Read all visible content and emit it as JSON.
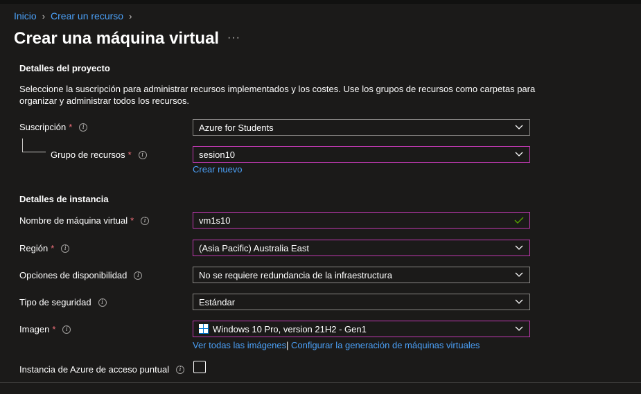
{
  "breadcrumb": {
    "home": "Inicio",
    "create_resource": "Crear un recurso"
  },
  "page": {
    "title": "Crear una máquina virtual",
    "more": "···"
  },
  "project": {
    "heading": "Detalles del proyecto",
    "description": "Seleccione la suscripción para administrar recursos implementados y los costes. Use los grupos de recursos como carpetas para organizar y administrar todos los recursos.",
    "subscription_label": "Suscripción",
    "subscription_value": "Azure for Students",
    "resource_group_label": "Grupo de recursos",
    "resource_group_value": "sesion10",
    "create_new_link": "Crear nuevo"
  },
  "instance": {
    "heading": "Detalles de instancia",
    "vm_name_label": "Nombre de máquina virtual",
    "vm_name_value": "vm1s10",
    "region_label": "Región",
    "region_value": "(Asia Pacific) Australia East",
    "availability_label": "Opciones de disponibilidad",
    "availability_value": "No se requiere redundancia de la infraestructura",
    "security_label": "Tipo de seguridad",
    "security_value": "Estándar",
    "image_label": "Imagen",
    "image_value": "Windows 10 Pro, version 21H2 - Gen1",
    "see_all_images_link": "Ver todas las imágenes",
    "link_separator": "|",
    "configure_generation_link": "Configurar la generación de máquinas virtuales",
    "spot_label": "Instancia de Azure de acceso puntual"
  },
  "common": {
    "required_mark": "*",
    "info_glyph": "i"
  },
  "icons": {
    "chevron": "chevron-down-icon",
    "info": "info-icon",
    "check": "check-icon",
    "windows": "windows-logo-icon"
  },
  "colors": {
    "background": "#1b1a19",
    "link": "#4ba0f7",
    "required": "#f1707b",
    "active_border": "#c239b3",
    "valid_check": "#57a300"
  }
}
